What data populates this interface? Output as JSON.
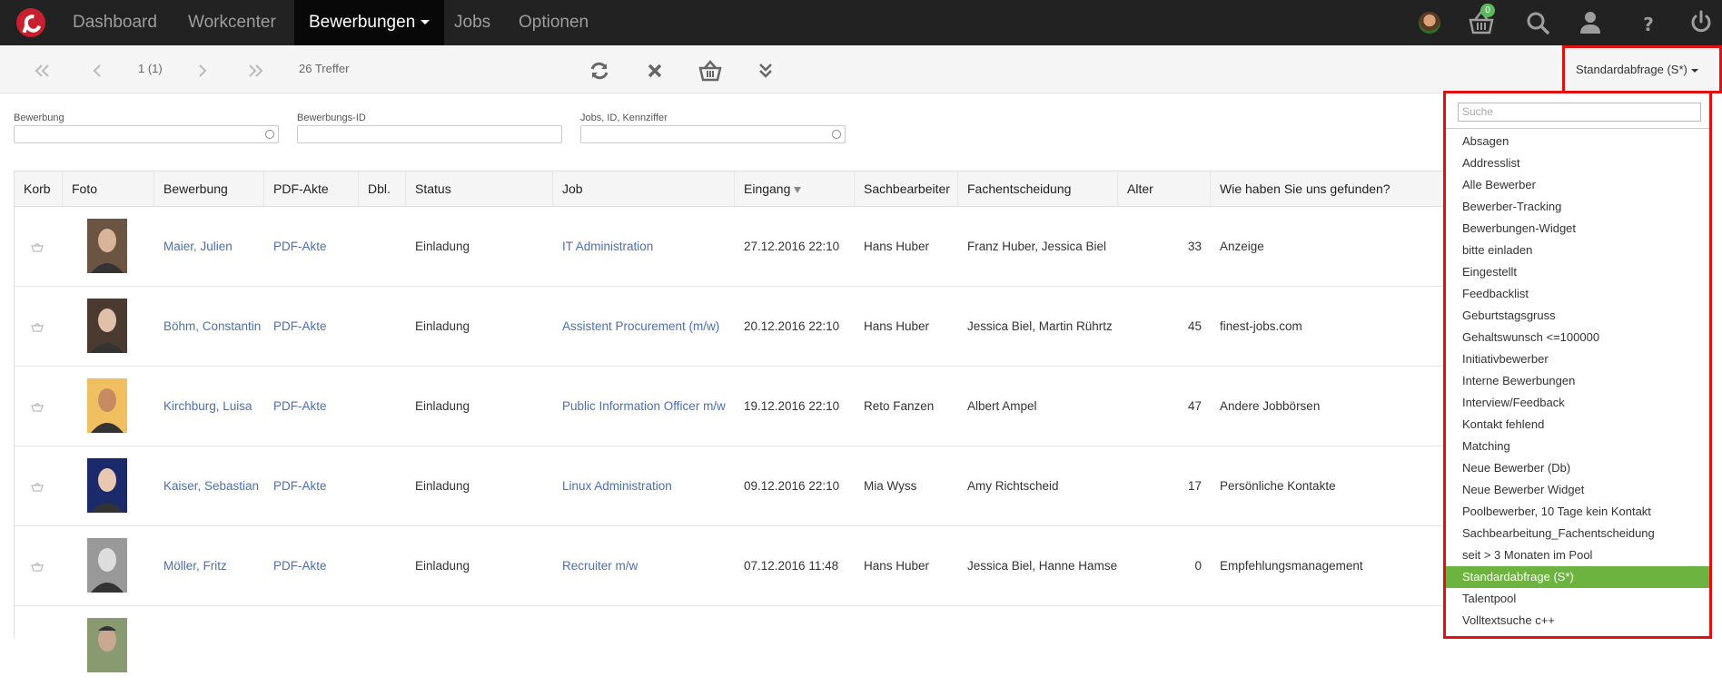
{
  "nav": {
    "items": [
      "Dashboard",
      "Workcenter",
      "Bewerbungen",
      "Jobs",
      "Optionen"
    ],
    "active_index": 2,
    "cart_count": "0",
    "icons": [
      "avatar",
      "basket-icon",
      "search-icon",
      "user-icon",
      "help-icon",
      "power-icon"
    ]
  },
  "toolbar": {
    "page": "1 (1)",
    "hits": "26 Treffer",
    "saved_query": "Standardabfrage (S*)"
  },
  "filters": [
    {
      "label": "Bewerbung",
      "value": ""
    },
    {
      "label": "Bewerbungs-ID",
      "value": ""
    },
    {
      "label": "Jobs, ID, Kennziffer",
      "value": ""
    }
  ],
  "table": {
    "columns": [
      "Korb",
      "Foto",
      "Bewerbung",
      "PDF-Akte",
      "Dbl.",
      "Status",
      "Job",
      "Eingang",
      "Sachbearbeiter",
      "Fachentscheidung",
      "Alter",
      "Wie haben Sie uns gefunden?"
    ],
    "sorted_column": "Eingang",
    "sort_direction": "desc",
    "rows": [
      {
        "name": "Maier, Julien",
        "pdf": "PDF-Akte",
        "status": "Einladung",
        "job": "IT Administration",
        "eingang": "27.12.2016 22:10",
        "sachbearbeiter": "Hans Huber",
        "fachentscheidung": "Franz Huber, Jessica Biel",
        "alter": "33",
        "quelle": "Anzeige"
      },
      {
        "name": "Böhm, Constantin",
        "pdf": "PDF-Akte",
        "status": "Einladung",
        "job": "Assistent Procurement (m/w)",
        "eingang": "20.12.2016 22:10",
        "sachbearbeiter": "Hans Huber",
        "fachentscheidung": "Jessica Biel, Martin Rührtz",
        "alter": "45",
        "quelle": "finest-jobs.com"
      },
      {
        "name": "Kirchburg, Luisa",
        "pdf": "PDF-Akte",
        "status": "Einladung",
        "job": "Public Information Officer m/w",
        "eingang": "19.12.2016 22:10",
        "sachbearbeiter": "Reto Fanzen",
        "fachentscheidung": "Albert Ampel",
        "alter": "47",
        "quelle": "Andere Jobbörsen"
      },
      {
        "name": "Kaiser, Sebastian",
        "pdf": "PDF-Akte",
        "status": "Einladung",
        "job": "Linux Administration",
        "eingang": "09.12.2016 22:10",
        "sachbearbeiter": "Mia Wyss",
        "fachentscheidung": "Amy Richtscheid",
        "alter": "17",
        "quelle": "Persönliche Kontakte"
      },
      {
        "name": "Möller, Fritz",
        "pdf": "PDF-Akte",
        "status": "Einladung",
        "job": "Recruiter m/w",
        "eingang": "07.12.2016 11:48",
        "sachbearbeiter": "Hans Huber",
        "fachentscheidung": "Jessica Biel, Hanne Hamsel",
        "alter": "0",
        "quelle": "Empfehlungsmanagement"
      }
    ]
  },
  "dropdown": {
    "search_placeholder": "Suche",
    "selected_index": 20,
    "items": [
      "Absagen",
      "Addresslist",
      "Alle Bewerber",
      "Bewerber-Tracking",
      "Bewerbungen-Widget",
      "bitte einladen",
      "Eingestellt",
      "Feedbacklist",
      "Geburtstagsgruss",
      "Gehaltswunsch <=100000",
      "Initiativbewerber",
      "Interne Bewerbungen",
      "Interview/Feedback",
      "Kontakt fehlend",
      "Matching",
      "Neue Bewerber (Db)",
      "Neue Bewerber Widget",
      "Poolbewerber, 10 Tage kein Kontakt",
      "Sachbearbeitung_Fachentscheidung",
      "seit > 3 Monaten im Pool",
      "Standardabfrage (S*)",
      "Talentpool",
      "Volltextsuche c++"
    ]
  },
  "colors": {
    "nav_bg": "#222222",
    "accent_green": "#6cb33f",
    "link": "#4a6fb5",
    "highlight_border": "#e01010",
    "logo": "#c8202f"
  }
}
